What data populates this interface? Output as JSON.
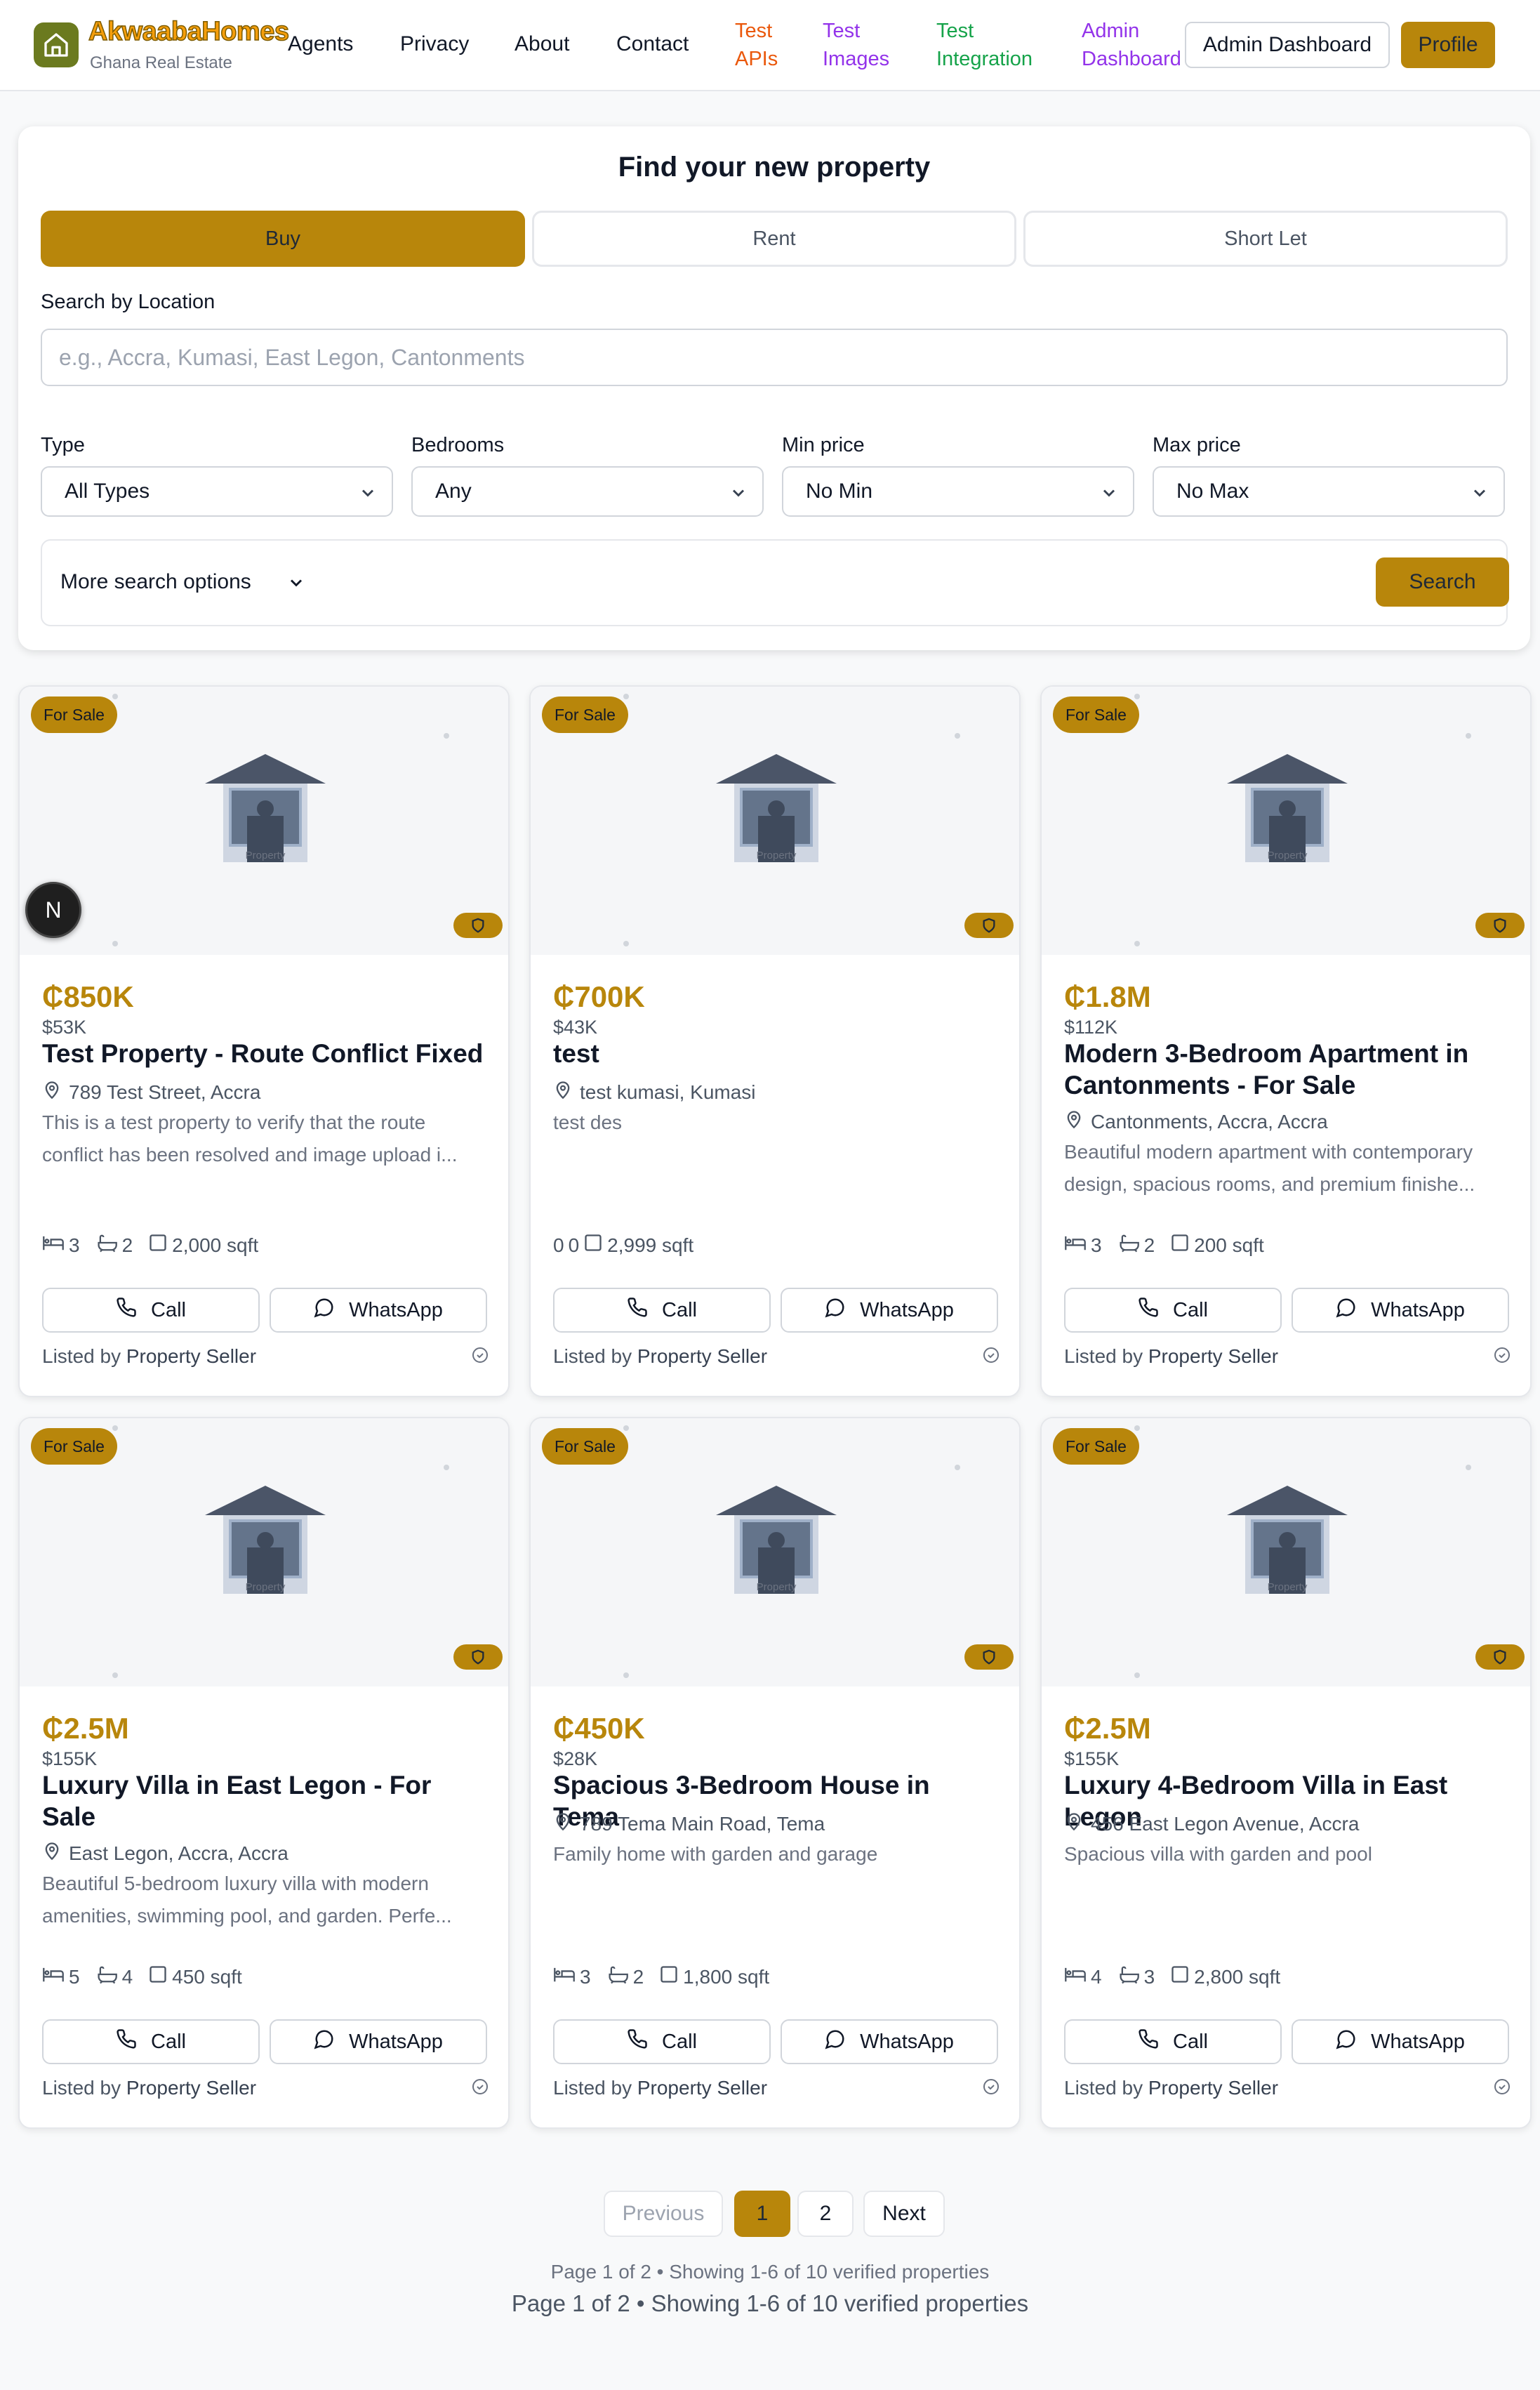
{
  "header": {
    "brand": "AkwaabaHomes",
    "tagline": "Ghana Real Estate",
    "nav": [
      "Agents",
      "Privacy",
      "About",
      "Contact"
    ],
    "test_apis": [
      "Test",
      "APIs"
    ],
    "test_images": [
      "Test",
      "Images"
    ],
    "test_integration": [
      "Test",
      "Integration"
    ],
    "admin_dashboard_link": [
      "Admin",
      "Dashboard"
    ],
    "admin_dashboard_button": "Admin Dashboard",
    "profile_button": "Profile",
    "colors": {
      "test_apis": "#ea580c",
      "test_images": "#9333ea",
      "test_integration": "#16a34a",
      "admin_link": "#9333ea",
      "accent": "#b8860b"
    }
  },
  "search": {
    "title": "Find your new property",
    "tabs": [
      "Buy",
      "Rent",
      "Short Let"
    ],
    "active_tab": "Buy",
    "location_label": "Search by Location",
    "location_placeholder": "e.g., Accra, Kumasi, East Legon, Cantonments",
    "filters": [
      {
        "label": "Type",
        "value": "All Types"
      },
      {
        "label": "Bedrooms",
        "value": "Any"
      },
      {
        "label": "Min price",
        "value": "No Min"
      },
      {
        "label": "Max price",
        "value": "No Max"
      }
    ],
    "more_options": "More search options",
    "search_button": "Search"
  },
  "listings": [
    {
      "badge": "For Sale",
      "price": "₵850K",
      "usd": "$53K",
      "title": "Test Property - Route Conflict Fixed",
      "location": "789 Test Street, Accra",
      "description": "This is a test property to verify that the route conflict has been resolved and image upload i...",
      "beds": "3",
      "baths": "2",
      "area": "2,000 sqft",
      "call": "Call",
      "whatsapp": "WhatsApp",
      "listed_by_prefix": "Listed by ",
      "listed_by": "Property Seller",
      "image_caption": "Property"
    },
    {
      "badge": "For Sale",
      "price": "₵700K",
      "usd": "$43K",
      "title": "test",
      "location": "test kumasi, Kumasi",
      "description": "test des",
      "beds": "0",
      "baths": "0",
      "area": "2,999 sqft",
      "call": "Call",
      "whatsapp": "WhatsApp",
      "listed_by_prefix": "Listed by ",
      "listed_by": "Property Seller",
      "image_caption": "Property"
    },
    {
      "badge": "For Sale",
      "price": "₵1.8M",
      "usd": "$112K",
      "title": "Modern 3-Bedroom Apartment in Cantonments - For Sale",
      "location": "Cantonments, Accra, Accra",
      "description": "Beautiful modern apartment with contemporary design, spacious rooms, and premium finishe...",
      "beds": "3",
      "baths": "2",
      "area": "200 sqft",
      "call": "Call",
      "whatsapp": "WhatsApp",
      "listed_by_prefix": "Listed by ",
      "listed_by": "Property Seller",
      "image_caption": "Property"
    },
    {
      "badge": "For Sale",
      "price": "₵2.5M",
      "usd": "$155K",
      "title": "Luxury Villa in East Legon - For Sale",
      "location": "East Legon, Accra, Accra",
      "description": "Beautiful 5-bedroom luxury villa with modern amenities, swimming pool, and garden. Perfe...",
      "beds": "5",
      "baths": "4",
      "area": "450 sqft",
      "call": "Call",
      "whatsapp": "WhatsApp",
      "listed_by_prefix": "Listed by ",
      "listed_by": "Property Seller",
      "image_caption": "Property"
    },
    {
      "badge": "For Sale",
      "price": "₵450K",
      "usd": "$28K",
      "title": "Spacious 3-Bedroom House in Tema",
      "location": "789 Tema Main Road, Tema",
      "description": "Family home with garden and garage",
      "beds": "3",
      "baths": "2",
      "area": "1,800 sqft",
      "call": "Call",
      "whatsapp": "WhatsApp",
      "listed_by_prefix": "Listed by ",
      "listed_by": "Property Seller",
      "image_caption": "Property"
    },
    {
      "badge": "For Sale",
      "price": "₵2.5M",
      "usd": "$155K",
      "title": "Luxury 4-Bedroom Villa in East Legon",
      "location": "456 East Legon Avenue, Accra",
      "description": "Spacious villa with garden and pool",
      "beds": "4",
      "baths": "3",
      "area": "2,800 sqft",
      "call": "Call",
      "whatsapp": "WhatsApp",
      "listed_by_prefix": "Listed by ",
      "listed_by": "Property Seller",
      "image_caption": "Property"
    }
  ],
  "overlay_badge": "N",
  "pagination": {
    "previous": "Previous",
    "pages": [
      "1",
      "2"
    ],
    "current": "1",
    "next": "Next",
    "info_small": "Page 1 of 2 • Showing 1-6 of 10 verified properties",
    "info_large": "Page 1 of 2 • Showing 1-6 of 10 verified properties"
  }
}
